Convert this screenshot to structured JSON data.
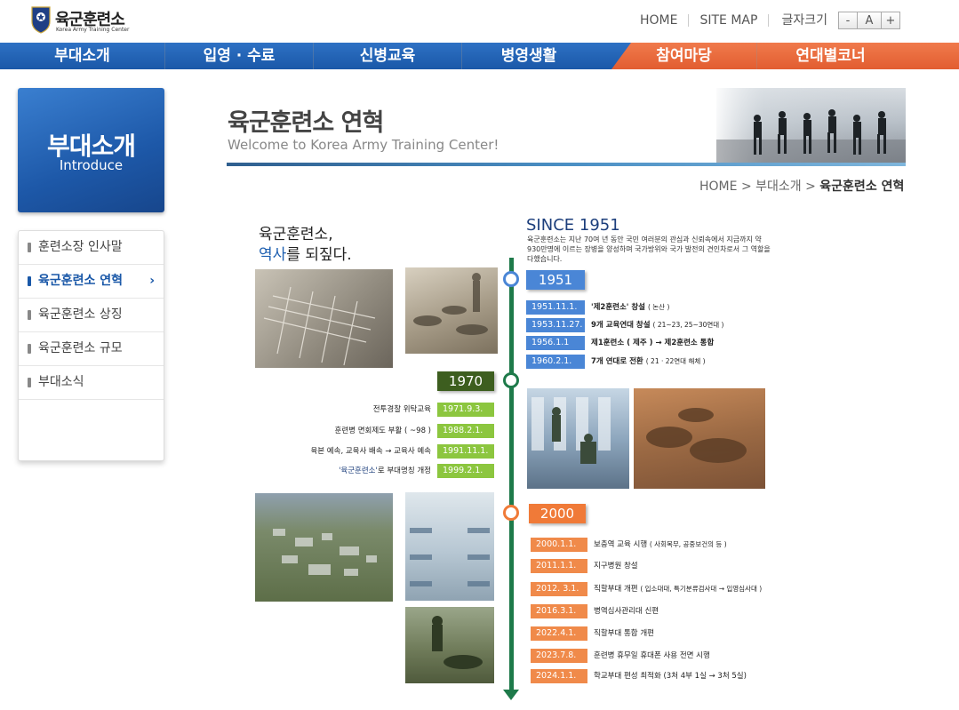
{
  "header": {
    "logo_name": "육군훈련소",
    "logo_sub": "Korea Army Training Center",
    "nav": [
      "HOME",
      "SITE MAP"
    ],
    "font_size_label": "글자크기",
    "font_buttons": [
      "-",
      "A",
      "+"
    ]
  },
  "mainnav": {
    "items": [
      "부대소개",
      "입영 · 수료",
      "신병교육",
      "병영생활",
      "참여마당",
      "연대별코너"
    ]
  },
  "sidebar": {
    "title": "부대소개",
    "subtitle": "Introduce",
    "items": [
      {
        "label": "훈련소장 인사말"
      },
      {
        "label": "육군훈련소 연혁"
      },
      {
        "label": "육군훈련소 상징"
      },
      {
        "label": "육군훈련소 규모"
      },
      {
        "label": "부대소식"
      }
    ],
    "active_chevron": "›"
  },
  "page": {
    "title": "육군훈련소 연혁",
    "subtitle": "Welcome to Korea Army Training Center!",
    "breadcrumb": {
      "home": "HOME",
      "sep": ">",
      "section": "부대소개",
      "current": "육군훈련소 연혁"
    }
  },
  "timeline": {
    "intro_line1": "육군훈련소,",
    "intro_line2_hl": "역사",
    "intro_line2_rest": "를 되짚다.",
    "since": "SINCE 1951",
    "since_desc": "육군훈련소는 지난 70여 년 동안 국민 여러분의 관심과 신뢰속에서 지금까지 약 930만명에 이르는 장병을 양성하며 국가방위와 국가 발전의 견인차로서 그 역할을 다했습니다.",
    "era1951": {
      "year": "1951",
      "events": [
        {
          "date": "1951.11.1.",
          "text": "'제2훈련소' 창설",
          "note": "( 논산 )"
        },
        {
          "date": "1953.11.27.",
          "text": "9개 교육연대 창설",
          "note": "( 21~23, 25~30연대 )"
        },
        {
          "date": "1956.1.1",
          "text": "제1훈련소 ( 제주 ) → 제2훈련소 통합",
          "note": ""
        },
        {
          "date": "1960.2.1.",
          "text": "7개 연대로 전환",
          "note": "( 21 · 22연대 해체 )"
        }
      ]
    },
    "era1970": {
      "year": "1970",
      "events": [
        {
          "text": "전투경찰 위탁교육",
          "date": "1971.9.3."
        },
        {
          "text": "훈련병 면회제도 부활 ( ~98 )",
          "date": "1988.2.1."
        },
        {
          "text": "육본 예속, 교육사 배속 → 교육사 예속",
          "date": "1991.11.1."
        },
        {
          "text_hl": "'육군훈련소'",
          "text": "로 부대명칭 개정",
          "date": "1999.2.1."
        }
      ]
    },
    "era2000": {
      "year": "2000",
      "events": [
        {
          "date": "2000.1.1.",
          "text": "보충역 교육 시행",
          "note": "( 사회복무, 공중보건의 등 )"
        },
        {
          "date": "2011.1.1.",
          "text": "지구병원 창설",
          "note": ""
        },
        {
          "date": "2012. 3.1.",
          "text": "직할부대 개편",
          "note": "( 입소대대, 특기분류검사대 → 입영심사대 )"
        },
        {
          "date": "2016.3.1.",
          "text": "병역심사관리대 신편",
          "note": ""
        },
        {
          "date": "2022.4.1.",
          "text": "직할부대 통합 개편",
          "note": ""
        },
        {
          "date": "2023.7.8.",
          "text": "훈련병 휴무일 휴대폰 사용 전면 시행",
          "note": ""
        },
        {
          "date": "2024.1.1.",
          "text": "학교부대 편성 최적화 (3처 4부 1실 → 3처 5실)",
          "note": ""
        }
      ]
    }
  },
  "colors": {
    "nav_blue": "#1a58a8",
    "nav_orange": "#e25d30",
    "era1951": "#4a86d6",
    "era1970_tag": "#3d5e1f",
    "era1970_date": "#8cc63f",
    "era2000": "#f07a38",
    "trunk": "#1e7a4a"
  }
}
